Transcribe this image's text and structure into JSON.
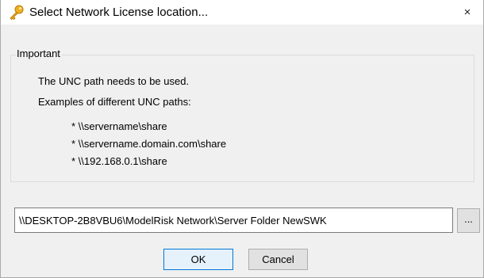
{
  "window": {
    "title": "Select Network License location...",
    "close_label": "×",
    "title_icon": "key-icon",
    "close_icon": "close-icon"
  },
  "group": {
    "legend": "Important",
    "lines": [
      "The UNC path needs to be used.",
      "Examples of different UNC paths:"
    ],
    "examples": [
      "* \\\\servername\\share",
      "* \\\\servername.domain.com\\share",
      "* \\\\192.168.0.1\\share"
    ]
  },
  "path": {
    "value": "\\\\DESKTOP-2B8VBU6\\ModelRisk Network\\Server Folder NewSWK"
  },
  "buttons": {
    "browse_label": "...",
    "ok_label": "OK",
    "cancel_label": "Cancel"
  },
  "colors": {
    "window_bg": "#f0f0f0",
    "titlebar_bg": "#ffffff",
    "default_button_border": "#0078d7",
    "key_icon": "#e8a317"
  }
}
